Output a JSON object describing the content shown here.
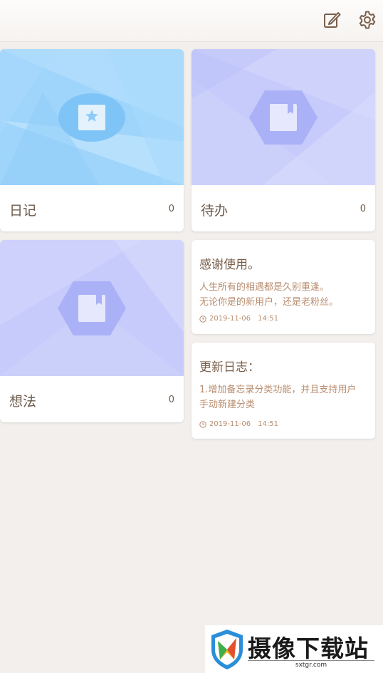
{
  "toolbar": {
    "edit_icon": "edit-note-icon",
    "settings_icon": "gear-icon"
  },
  "categories": [
    {
      "name": "日记",
      "count": "0",
      "icon": "star-note-icon",
      "theme": "#9ed4fb"
    },
    {
      "name": "待办",
      "count": "0",
      "icon": "bookmark-book-icon",
      "theme": "#c9cdfb"
    },
    {
      "name": "想法",
      "count": "0",
      "icon": "bookmark-book-icon",
      "theme": "#c9cdfb"
    }
  ],
  "notes": [
    {
      "title": "感谢使用。",
      "lines": [
        "人生所有的相遇都是久别重逢。",
        "无论你是的新用户，还是老粉丝。"
      ],
      "date": "2019-11-06",
      "time": "14:51"
    },
    {
      "title": "更新日志：",
      "lines": [
        "1.增加备忘录分类功能，并且支持用户",
        "手动新建分类"
      ],
      "date": "2019-11-06",
      "time": "14:51"
    }
  ],
  "watermark": {
    "title": "摄像下载站",
    "domain": "sxtgr.com"
  }
}
